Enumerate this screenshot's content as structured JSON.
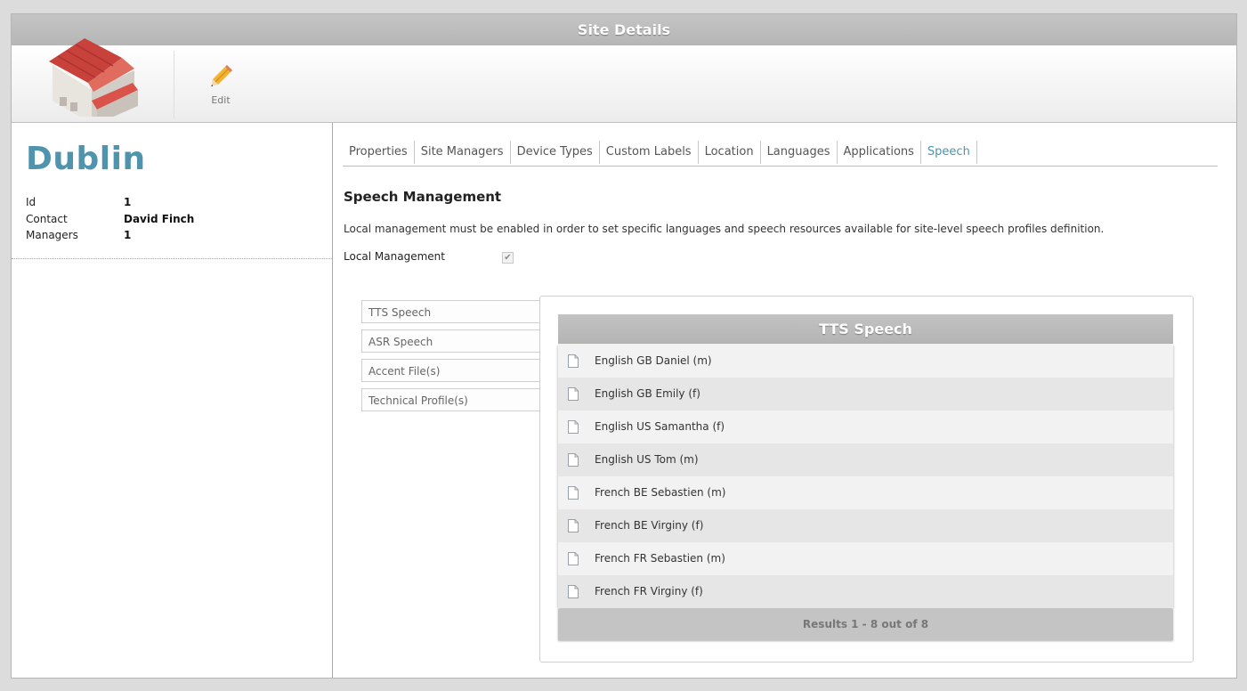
{
  "window": {
    "title": "Site Details"
  },
  "toolbar": {
    "edit_label": "Edit",
    "logo_icon": "warehouse-icon",
    "edit_icon": "pencil-icon"
  },
  "site": {
    "name": "Dublin",
    "fields": [
      {
        "label": "Id",
        "value": "1"
      },
      {
        "label": "Contact",
        "value": "David Finch"
      },
      {
        "label": "Managers",
        "value": "1"
      }
    ]
  },
  "tabs": [
    "Properties",
    "Site Managers",
    "Device Types",
    "Custom Labels",
    "Location",
    "Languages",
    "Applications",
    "Speech"
  ],
  "active_tab": "Speech",
  "speech": {
    "title": "Speech Management",
    "description": "Local management must be enabled in order to set specific languages and speech resources available for site-level speech profiles definition.",
    "local_management_label": "Local Management",
    "local_management_checked": true,
    "subtabs": [
      "TTS Speech",
      "ASR Speech",
      "Accent File(s)",
      "Technical Profile(s)"
    ],
    "grid": {
      "title": "TTS Speech",
      "rows": [
        "English GB Daniel (m)",
        "English GB Emily (f)",
        "English US Samantha (f)",
        "English US Tom (m)",
        "French BE Sebastien (m)",
        "French BE Virginy (f)",
        "French FR Sebastien (m)",
        "French FR Virginy (f)"
      ],
      "footer": "Results 1 - 8 out of 8",
      "row_icon": "document-icon"
    }
  },
  "colors": {
    "accent": "#4f93ad",
    "header_gray": "#b6b6b6"
  }
}
